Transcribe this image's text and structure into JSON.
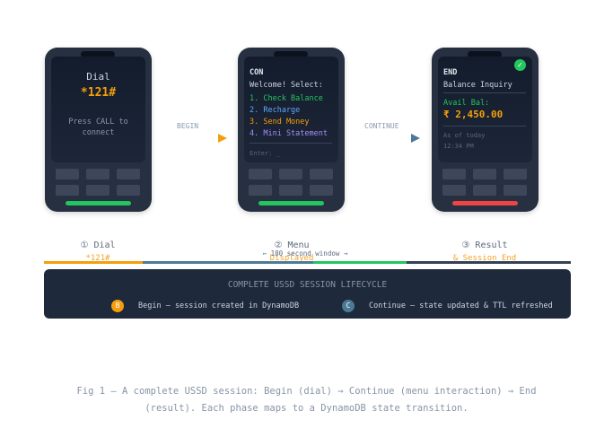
{
  "phones": [
    {
      "lines": {
        "title": "Dial",
        "code": "*121#",
        "hint1": "Press CALL to",
        "hint2": "connect"
      }
    },
    {
      "lines": {
        "header": "CON",
        "prompt": "Welcome! Select:",
        "o1": "1. Check Balance",
        "o2": "2. Recharge",
        "o3": "3. Send Money",
        "o4": "4. Mini Statement",
        "input": "Enter: _"
      }
    },
    {
      "lines": {
        "header": "END",
        "sub": "Balance Inquiry",
        "label": "Avail Bal:",
        "amount": "₹ 2,450.00",
        "note1": "As of today",
        "note2": "12:34 PM",
        "check": "✓"
      }
    }
  ],
  "connectors": {
    "begin": "BEGIN",
    "continue": "CONTINUE"
  },
  "phases": [
    {
      "title": "① Dial",
      "sub": "*121#"
    },
    {
      "title": "② Menu",
      "sub": "Displayed"
    },
    {
      "title": "③ Result",
      "sub": "& Session End"
    }
  ],
  "timeline": {
    "label": "← 180 second window →"
  },
  "legend": {
    "title": "COMPLETE USSD SESSION LIFECYCLE",
    "items": [
      {
        "badge": "B",
        "text": "Begin — session created in DynamoDB"
      },
      {
        "badge": "C",
        "text": "Continue — state updated & TTL refreshed"
      }
    ]
  },
  "caption": {
    "line1": "Fig 1 — A complete USSD session: Begin (dial) → Continue (menu interaction) → End",
    "line2": "(result). Each phase maps to a DynamoDB state transition."
  },
  "colors": {
    "begin": "#f59e0b",
    "continue": "#4b7a95",
    "menu_green": "#22c55e",
    "menu_blue": "#60a5fa",
    "menu_orange": "#f59e0b",
    "menu_purple": "#a78bfa",
    "end_red": "#ef4444"
  }
}
